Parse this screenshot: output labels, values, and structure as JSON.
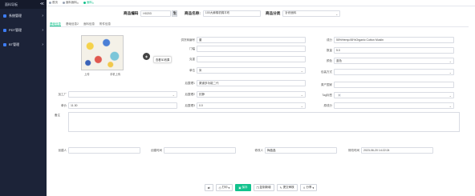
{
  "sidebar": {
    "brand": "面料导板",
    "fold_icon": "fold-icon",
    "items": [
      {
        "label": "系统管理"
      },
      {
        "label": "PDT管理"
      },
      {
        "label": "BT管理"
      }
    ]
  },
  "tabs": [
    {
      "label": "首页"
    },
    {
      "label": "面料面料"
    },
    {
      "label": "面料"
    }
  ],
  "header": {
    "code_label": "商品编码",
    "code_value": "H0203",
    "gen_label": "生",
    "name_label": "商品名称:",
    "name_value": "100大麻棉机棉平布",
    "category_label": "商品分类",
    "category_value": "针织面料"
  },
  "subtabs": [
    {
      "label": "基础信息"
    },
    {
      "label": "基础信息2"
    },
    {
      "label": "面料信息"
    },
    {
      "label": "附件信息"
    }
  ],
  "photo": {
    "upload": "上传",
    "phone_upload": "手机上传",
    "tip": "查看3D效果"
  },
  "fields": {
    "supplier_no": {
      "label": "供货商编号",
      "value": "董"
    },
    "width": {
      "label": "门幅",
      "value": ""
    },
    "weight": {
      "label": "克重",
      "value": ""
    },
    "unit": {
      "label": "单位",
      "value": "米"
    },
    "process1": {
      "label": "后整理1",
      "value": "渠道多功能二代"
    },
    "process2": {
      "label": "后整理2",
      "value": "抗静"
    },
    "process3": {
      "label": "后整理3",
      "value": "0.0"
    },
    "composition": {
      "label": "成分",
      "value": "55%Hemp/45%Organic Cotton Muslin"
    },
    "quantity": {
      "label": "数量",
      "value": "5.0"
    },
    "color": {
      "label": "颜色",
      "value": "蓝色"
    },
    "packing": {
      "label": "包装方式",
      "value": ""
    },
    "origin": {
      "label": "原产国家",
      "value": ""
    },
    "sample": {
      "label": "样品编号",
      "value": ""
    },
    "tag_label": {
      "label": "Tag标签",
      "value": "x"
    },
    "price_label": {
      "label": "单价",
      "value": "11.30"
    },
    "factory": {
      "label": "加工厂",
      "value": ""
    },
    "ingredient_label": {
      "label": "原成分",
      "value": ""
    },
    "notes": {
      "label": "备注",
      "value": ""
    }
  },
  "footer": {
    "creator_label": "创建人",
    "creator_value": "",
    "create_time_label": "创建时间",
    "create_time_value": "",
    "modifier_label": "修改人",
    "modifier_value": "梅晶晶",
    "modify_time_label": "修改时间",
    "modify_time_value": "2023-06-20 14:22:24"
  },
  "actions": {
    "refresh": "",
    "print": "打印",
    "save": "保存",
    "copy_new": "复制新增",
    "submit_review": "提交审核",
    "share": "分享"
  },
  "colors": {
    "accent": "#13c28d",
    "sidebar": "#1c2338"
  }
}
